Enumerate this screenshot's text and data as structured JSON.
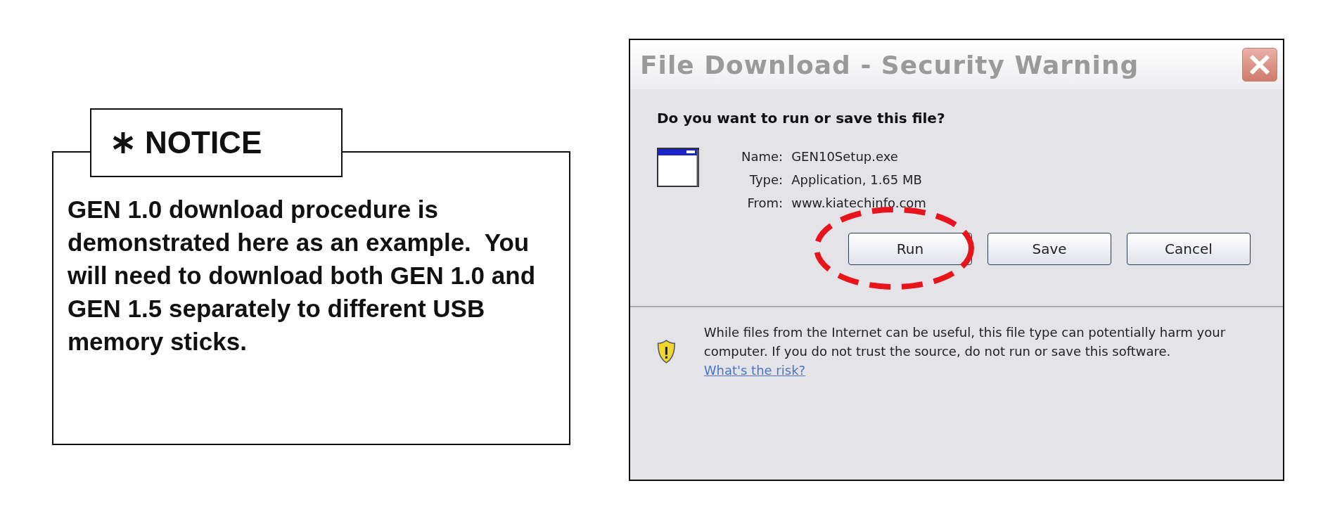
{
  "notice": {
    "label": "NOTICE",
    "body": "GEN 1.0 download procedure is demonstrated here as an example.  You will need to download both GEN 1.0 and GEN 1.5 separately to different USB memory sticks."
  },
  "dialog": {
    "title": "File Download - Security Warning",
    "question": "Do you want to run or save this file?",
    "fields": [
      {
        "label": "Name:",
        "value": "GEN10Setup.exe"
      },
      {
        "label": "Type:",
        "value": "Application, 1.65 MB"
      },
      {
        "label": "From:",
        "value": "www.kiatechinfo.com"
      }
    ],
    "buttons": [
      {
        "label": "Run",
        "circled": true
      },
      {
        "label": "Save",
        "circled": false
      },
      {
        "label": "Cancel",
        "circled": false
      }
    ],
    "warning": "While files from the Internet can be useful, this file type can potentially harm your computer. If you do not trust the source, do not run or save this software.",
    "risk_link": "What's the risk?"
  }
}
